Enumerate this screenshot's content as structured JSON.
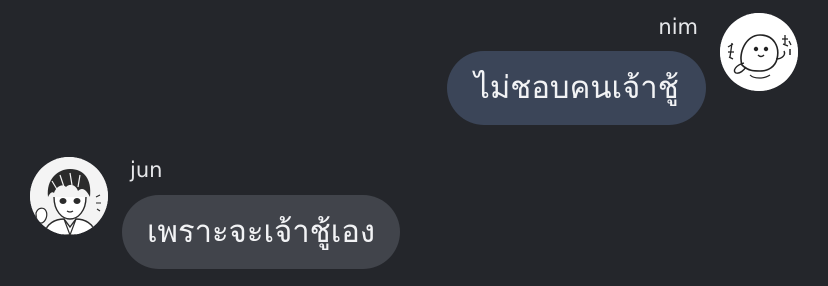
{
  "colors": {
    "background": "#24262b",
    "outgoing_bubble": "#3b4558",
    "incoming_bubble": "#41444b",
    "text": "#f2f3f5",
    "name_text": "#e6e7ea"
  },
  "messages": [
    {
      "sender": "nim",
      "direction": "outgoing",
      "text": "ไม่ชอบคนเจ้าชู้",
      "avatar_icon": "seal-sketch-avatar-icon"
    },
    {
      "sender": "jun",
      "direction": "incoming",
      "text": "เพราะจะเจ้าชู้เอง",
      "avatar_icon": "manga-boy-avatar-icon"
    }
  ]
}
